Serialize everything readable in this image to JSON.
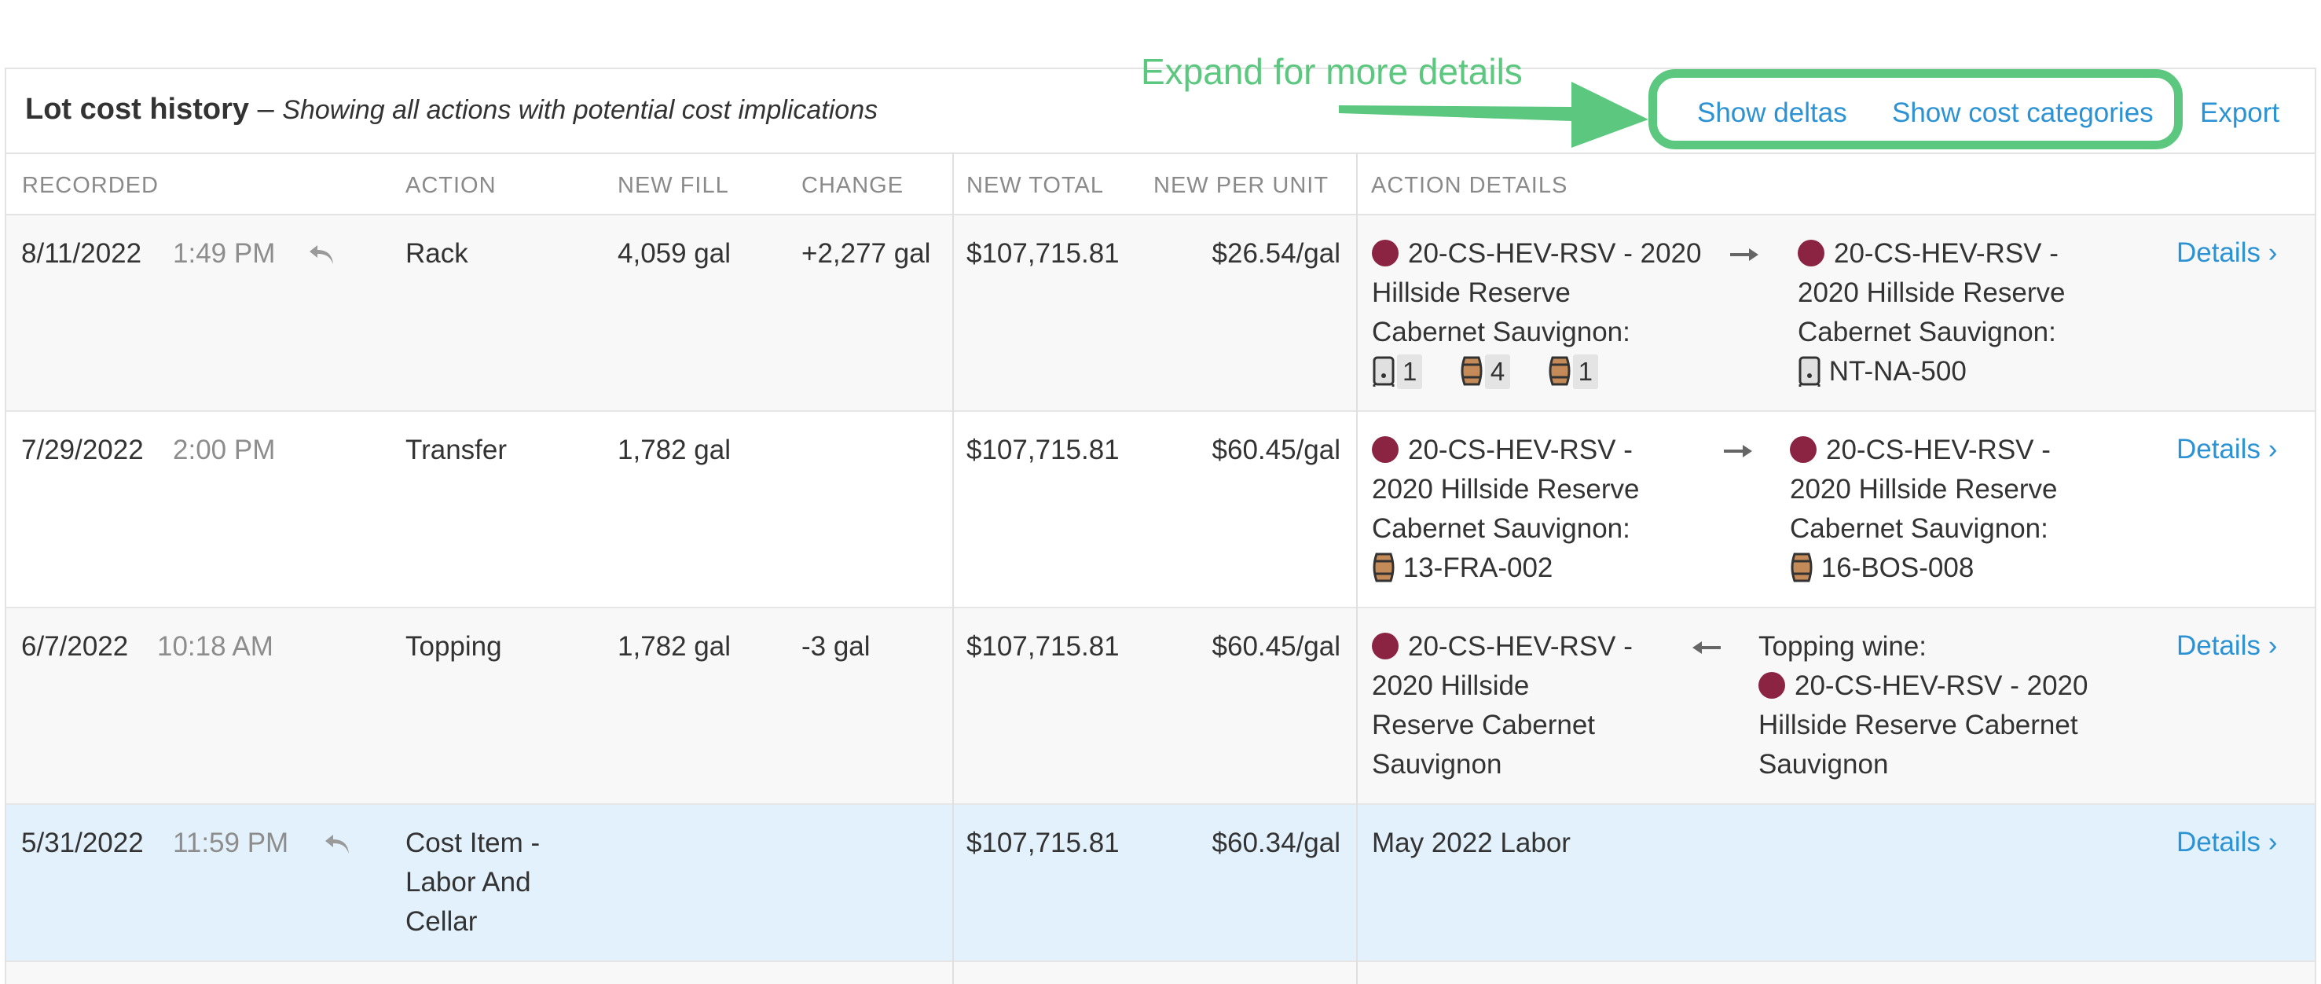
{
  "header": {
    "title_bold": "Lot cost history",
    "title_dash": " – ",
    "title_italic": "Showing all actions with potential cost implications",
    "show_deltas": "Show deltas",
    "show_cost_categories": "Show cost categories",
    "export": "Export"
  },
  "annotation": {
    "text": "Expand for more details"
  },
  "columns": {
    "recorded": "RECORDED",
    "action": "ACTION",
    "new_fill": "NEW FILL",
    "change": "CHANGE",
    "new_total": "NEW TOTAL",
    "new_per_unit": "NEW PER UNIT",
    "action_details": "ACTION DETAILS"
  },
  "rows": [
    {
      "date": "8/11/2022",
      "time": "1:49 PM",
      "action": "Rack",
      "new_fill": "4,059 gal",
      "change": "+2,277 gal",
      "new_total": "$107,715.81",
      "per_unit": "$26.54/gal",
      "from_lines": [
        "20-CS-HEV-RSV - 2020",
        "Hillside Reserve",
        "Cabernet Sauvignon:"
      ],
      "from_badges": [
        "1",
        "4",
        "1"
      ],
      "to_lines": [
        "20-CS-HEV-RSV -",
        "2020 Hillside Reserve",
        "Cabernet Sauvignon:"
      ],
      "to_vessel": "NT-NA-500",
      "details": "Details"
    },
    {
      "date": "7/29/2022",
      "time": "2:00 PM",
      "action": "Transfer",
      "new_fill": "1,782 gal",
      "change": "",
      "new_total": "$107,715.81",
      "per_unit": "$60.45/gal",
      "from_lines": [
        "20-CS-HEV-RSV -",
        "2020 Hillside Reserve",
        "Cabernet Sauvignon:"
      ],
      "from_vessel": "13-FRA-002",
      "to_lines": [
        "20-CS-HEV-RSV -",
        "2020 Hillside Reserve",
        "Cabernet Sauvignon:"
      ],
      "to_vessel": "16-BOS-008",
      "details": "Details"
    },
    {
      "date": "6/7/2022",
      "time": "10:18 AM",
      "action": "Topping",
      "new_fill": "1,782 gal",
      "change": "-3 gal",
      "new_total": "$107,715.81",
      "per_unit": "$60.45/gal",
      "from_lines": [
        "20-CS-HEV-RSV -",
        "2020 Hillside",
        "Reserve Cabernet",
        "Sauvignon"
      ],
      "to_header": "Topping wine:",
      "to_lines": [
        "20-CS-HEV-RSV - 2020",
        "Hillside Reserve Cabernet",
        "Sauvignon"
      ],
      "details": "Details"
    },
    {
      "date": "5/31/2022",
      "time": "11:59 PM",
      "action_lines": [
        "Cost Item -",
        "Labor And",
        "Cellar"
      ],
      "new_total": "$107,715.81",
      "per_unit": "$60.34/gal",
      "detail_text": "May 2022 Labor",
      "details": "Details"
    }
  ],
  "colors": {
    "link": "#2b92d4",
    "annotation": "#5bc77f",
    "wine_dot": "#8b2442",
    "highlight_row": "#e2f1fb",
    "alt_row": "#f8f8f8"
  }
}
